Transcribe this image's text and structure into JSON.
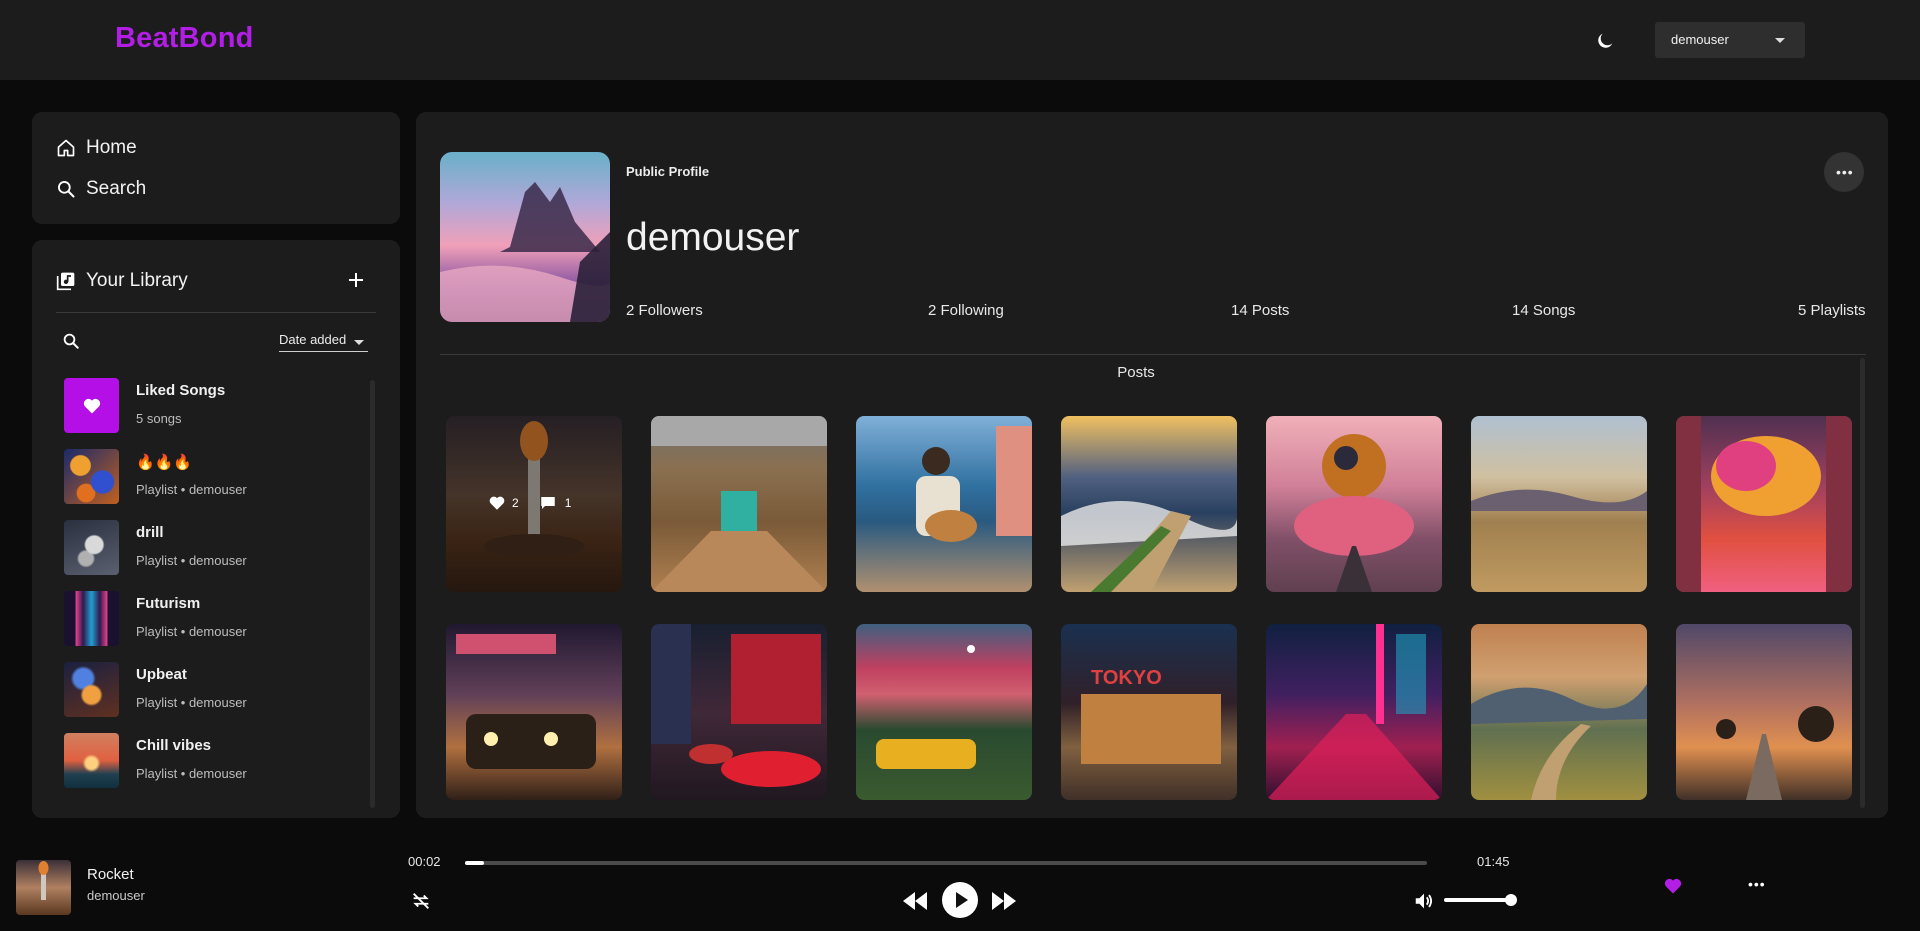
{
  "app": {
    "name": "BeatBond"
  },
  "header": {
    "username": "demouser",
    "theme_icon": "moon-icon"
  },
  "nav": {
    "items": [
      {
        "label": "Home",
        "icon": "home-icon"
      },
      {
        "label": "Search",
        "icon": "search-icon"
      }
    ]
  },
  "library": {
    "title": "Your Library",
    "sort_label": "Date added",
    "items": [
      {
        "title": "Liked Songs",
        "subtitle": "5 songs"
      },
      {
        "title": "🔥🔥🔥",
        "subtitle": "Playlist • demouser"
      },
      {
        "title": "drill",
        "subtitle": "Playlist • demouser"
      },
      {
        "title": "Futurism",
        "subtitle": "Playlist • demouser"
      },
      {
        "title": "Upbeat",
        "subtitle": "Playlist • demouser"
      },
      {
        "title": "Chill vibes",
        "subtitle": "Playlist • demouser"
      }
    ]
  },
  "profile": {
    "badge": "Public Profile",
    "username": "demouser",
    "stats": {
      "followers": "2 Followers",
      "following": "2 Following",
      "posts": "14 Posts",
      "songs": "14 Songs",
      "playlists": "5 Playlists"
    },
    "posts_title": "Posts",
    "first_post": {
      "likes": "2",
      "comments": "1"
    }
  },
  "player": {
    "title": "Rocket",
    "artist": "demouser",
    "current_time": "00:02",
    "total_time": "01:45",
    "progress_fraction": 0.02,
    "volume_fraction": 1.0,
    "liked": true,
    "accent_color": "#b21ee6"
  }
}
